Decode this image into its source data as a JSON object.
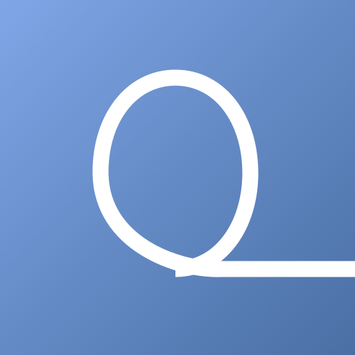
{
  "app_icon": {
    "icon": "loop-line-logo-icon",
    "colors": {
      "gradient_start": "#7fa6e6",
      "gradient_end": "#4a6fa5",
      "stroke": "#ffffff"
    }
  }
}
